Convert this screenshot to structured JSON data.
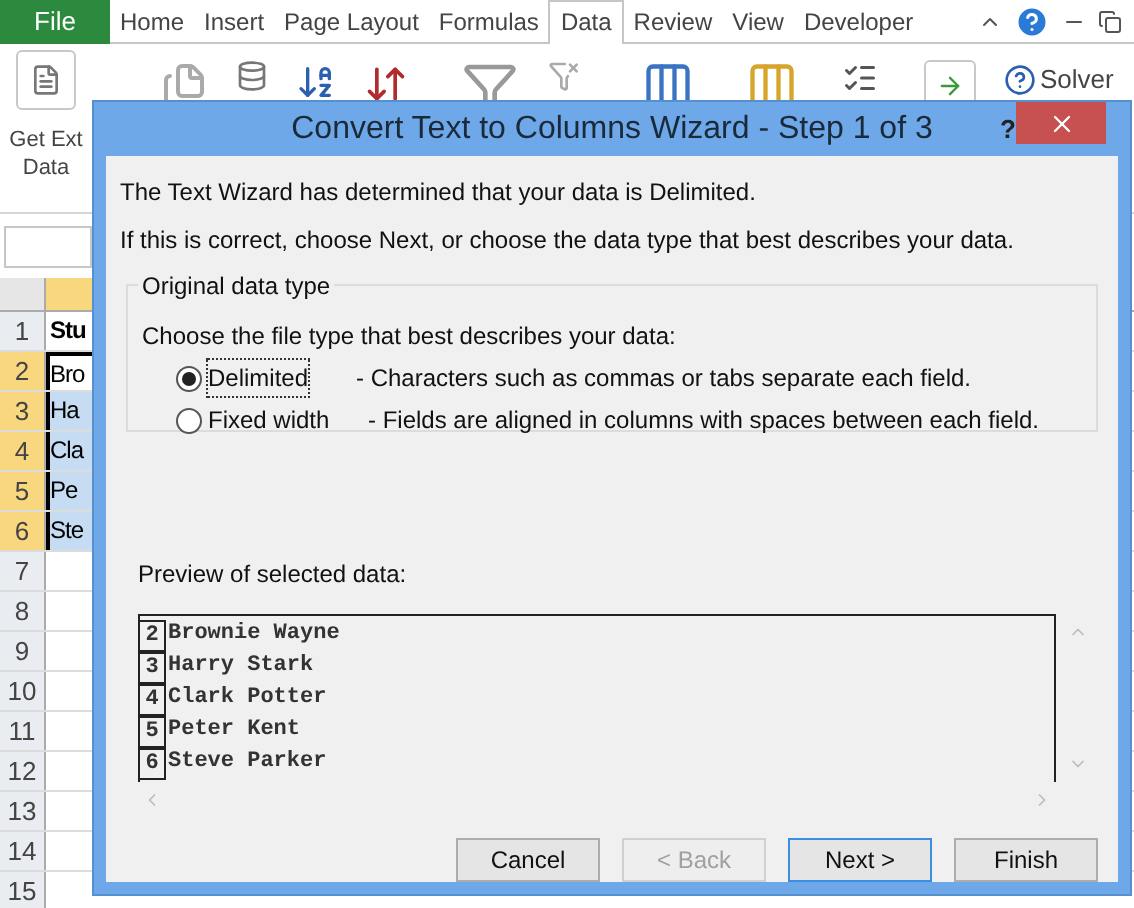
{
  "ribbon_tabs": [
    {
      "label": "File",
      "kind": "file",
      "selected": false
    },
    {
      "label": "Home",
      "kind": "tab",
      "selected": false
    },
    {
      "label": "Insert",
      "kind": "tab",
      "selected": false
    },
    {
      "label": "Page Layout",
      "kind": "tab",
      "selected": false
    },
    {
      "label": "Formulas",
      "kind": "tab",
      "selected": false
    },
    {
      "label": "Data",
      "kind": "tab",
      "selected": true
    },
    {
      "label": "Review",
      "kind": "tab",
      "selected": false
    },
    {
      "label": "View",
      "kind": "tab",
      "selected": false
    },
    {
      "label": "Developer",
      "kind": "tab",
      "selected": false
    }
  ],
  "ribbon": {
    "get_external_data": [
      "Get Ext",
      "Data"
    ],
    "solver": "Solver"
  },
  "sheet": {
    "rows": [
      {
        "header": "1",
        "cell": "Stu",
        "selected": false,
        "active": false
      },
      {
        "header": "2",
        "cell": "Bro",
        "selected": true,
        "active": true
      },
      {
        "header": "3",
        "cell": "Ha",
        "selected": true,
        "active": false
      },
      {
        "header": "4",
        "cell": "Cla",
        "selected": true,
        "active": false
      },
      {
        "header": "5",
        "cell": "Pe",
        "selected": true,
        "active": false
      },
      {
        "header": "6",
        "cell": "Ste",
        "selected": true,
        "active": false
      },
      {
        "header": "7",
        "selected": false,
        "active": false
      },
      {
        "header": "8",
        "selected": false,
        "active": false
      },
      {
        "header": "9",
        "selected": false,
        "active": false
      },
      {
        "header": "10",
        "selected": false,
        "active": false
      },
      {
        "header": "11",
        "selected": false,
        "active": false
      },
      {
        "header": "12",
        "selected": false,
        "active": false
      },
      {
        "header": "13",
        "selected": false,
        "active": false
      },
      {
        "header": "14",
        "selected": false,
        "active": false
      },
      {
        "header": "15",
        "selected": false,
        "active": false
      }
    ]
  },
  "dialog": {
    "title": "Convert Text to Columns Wizard - Step 1 of 3",
    "help": "?",
    "intro": [
      "The Text Wizard has determined that your data is Delimited.",
      "If this is correct, choose Next, or choose the data type that best describes your data."
    ],
    "group": {
      "legend": "Original data type",
      "prompt": "Choose the file type that best describes your data:",
      "options": [
        {
          "label": "Delimited",
          "description": "- Characters such as commas or tabs separate each field.",
          "selected": true
        },
        {
          "label": "Fixed width",
          "description": "- Fields are aligned in columns with spaces between each field.",
          "selected": false
        }
      ]
    },
    "preview": {
      "label": "Preview of selected data:",
      "lines": [
        {
          "number": "2",
          "text": "Brownie Wayne"
        },
        {
          "number": "3",
          "text": "Harry Stark"
        },
        {
          "number": "4",
          "text": "Clark Potter"
        },
        {
          "number": "5",
          "text": "Peter Kent"
        },
        {
          "number": "6",
          "text": "Steve Parker"
        }
      ]
    },
    "buttons": [
      {
        "label": "Cancel",
        "disabled": false,
        "default": false
      },
      {
        "label": "< Back",
        "disabled": true,
        "default": false
      },
      {
        "label": "Next >",
        "disabled": false,
        "default": true
      },
      {
        "label": "Finish",
        "disabled": false,
        "default": false
      }
    ]
  }
}
